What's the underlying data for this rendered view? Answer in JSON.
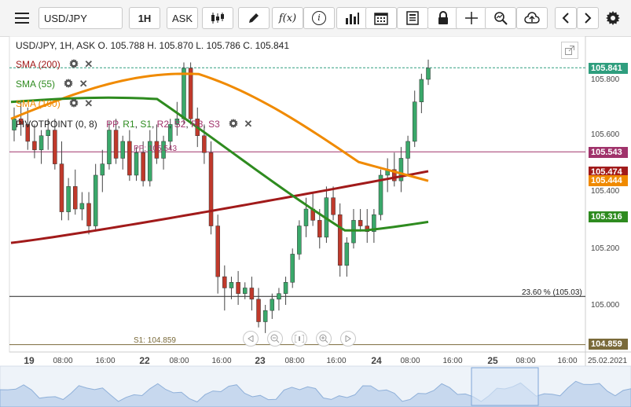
{
  "toolbar": {
    "symbol": "USD/JPY",
    "timeframe": "1H",
    "price_type": "ASK",
    "fx_label": "f(x)",
    "info_label": "i"
  },
  "header": {
    "ohlc": "USD/JPY, 1H, ASK   O. 105.788 H. 105.870 L. 105.786 C. 105.841"
  },
  "indicators": [
    {
      "label": "SMA (200)",
      "color": "#a11a1a"
    },
    {
      "label": "SMA (55)",
      "color": "#2e8b1f"
    },
    {
      "label": "SMA (100)",
      "color": "#f08a00"
    }
  ],
  "pivot": {
    "label_prefix": "PIVOTPOINT (0, 8)",
    "items": [
      "PP",
      "R1",
      "S1",
      "R2",
      "S2",
      "R3",
      "S3"
    ],
    "pp_label": "PP: 105.543",
    "s1_label": "S1: 104.859",
    "fib_label": "23.60 % (105.03)"
  },
  "price_tags": [
    {
      "value": "105.841",
      "color": "#2f9e7e"
    },
    {
      "value": "105.543",
      "color": "#a0336b"
    },
    {
      "value": "105.474",
      "color": "#a11a1a"
    },
    {
      "value": "105.444",
      "color": "#f08a00"
    },
    {
      "value": "105.316",
      "color": "#2e8b1f"
    },
    {
      "value": "104.859",
      "color": "#7a6a3a"
    }
  ],
  "y_axis": [
    "105.800",
    "105.600",
    "105.400",
    "105.200",
    "105.000"
  ],
  "x_axis": [
    {
      "label": "19",
      "big": true
    },
    {
      "label": "08:00"
    },
    {
      "label": "16:00"
    },
    {
      "label": "22",
      "big": true
    },
    {
      "label": "08:00"
    },
    {
      "label": "16:00"
    },
    {
      "label": "23",
      "big": true
    },
    {
      "label": "08:00"
    },
    {
      "label": "16:00"
    },
    {
      "label": "24",
      "big": true
    },
    {
      "label": "08:00"
    },
    {
      "label": "16:00"
    },
    {
      "label": "25",
      "big": true
    },
    {
      "label": "08:00"
    },
    {
      "label": "16:00"
    },
    {
      "label": "25.02.2021"
    }
  ],
  "chart_data": {
    "type": "candlestick",
    "symbol": "USD/JPY",
    "timeframe": "1H",
    "ylim": [
      104.8,
      105.9
    ],
    "last_close": 105.841,
    "levels": {
      "PP": 105.543,
      "S1": 104.859,
      "fib_23_6": 105.03
    },
    "sma": {
      "SMA(200)": 105.474,
      "SMA(100)": 105.444,
      "SMA(55)": 105.316
    },
    "candles": [
      [
        105.62,
        105.7,
        105.58,
        105.66
      ],
      [
        105.66,
        105.72,
        105.6,
        105.64
      ],
      [
        105.64,
        105.7,
        105.55,
        105.58
      ],
      [
        105.58,
        105.64,
        105.52,
        105.55
      ],
      [
        105.55,
        105.62,
        105.5,
        105.6
      ],
      [
        105.6,
        105.66,
        105.55,
        105.62
      ],
      [
        105.62,
        105.66,
        105.48,
        105.5
      ],
      [
        105.5,
        105.58,
        105.3,
        105.33
      ],
      [
        105.33,
        105.45,
        105.3,
        105.42
      ],
      [
        105.42,
        105.48,
        105.32,
        105.34
      ],
      [
        105.34,
        105.4,
        105.3,
        105.36
      ],
      [
        105.36,
        105.4,
        105.25,
        105.28
      ],
      [
        105.28,
        105.5,
        105.26,
        105.46
      ],
      [
        105.46,
        105.55,
        105.4,
        105.5
      ],
      [
        105.5,
        105.65,
        105.48,
        105.62
      ],
      [
        105.62,
        105.66,
        105.5,
        105.52
      ],
      [
        105.52,
        105.6,
        105.48,
        105.58
      ],
      [
        105.58,
        105.62,
        105.44,
        105.46
      ],
      [
        105.46,
        105.56,
        105.44,
        105.54
      ],
      [
        105.54,
        105.58,
        105.42,
        105.44
      ],
      [
        105.44,
        105.62,
        105.42,
        105.58
      ],
      [
        105.58,
        105.64,
        105.5,
        105.52
      ],
      [
        105.52,
        105.6,
        105.48,
        105.58
      ],
      [
        105.58,
        105.66,
        105.55,
        105.64
      ],
      [
        105.64,
        105.72,
        105.6,
        105.66
      ],
      [
        105.66,
        105.86,
        105.64,
        105.84
      ],
      [
        105.84,
        105.86,
        105.64,
        105.66
      ],
      [
        105.66,
        105.7,
        105.56,
        105.6
      ],
      [
        105.6,
        105.64,
        105.5,
        105.54
      ],
      [
        105.54,
        105.58,
        105.25,
        105.28
      ],
      [
        105.28,
        105.32,
        105.04,
        105.1
      ],
      [
        105.1,
        105.14,
        104.98,
        105.06
      ],
      [
        105.06,
        105.1,
        105.02,
        105.08
      ],
      [
        105.08,
        105.12,
        105.0,
        105.04
      ],
      [
        105.04,
        105.08,
        105.02,
        105.06
      ],
      [
        105.06,
        105.1,
        104.98,
        105.02
      ],
      [
        105.02,
        105.06,
        104.92,
        104.94
      ],
      [
        104.94,
        105.0,
        104.9,
        104.98
      ],
      [
        104.98,
        105.04,
        104.95,
        105.02
      ],
      [
        105.02,
        105.06,
        104.98,
        105.04
      ],
      [
        105.04,
        105.1,
        105.0,
        105.08
      ],
      [
        105.08,
        105.2,
        105.06,
        105.18
      ],
      [
        105.18,
        105.3,
        105.16,
        105.28
      ],
      [
        105.28,
        105.38,
        105.24,
        105.34
      ],
      [
        105.34,
        105.4,
        105.28,
        105.3
      ],
      [
        105.3,
        105.34,
        105.2,
        105.24
      ],
      [
        105.24,
        105.42,
        105.22,
        105.38
      ],
      [
        105.38,
        105.42,
        105.3,
        105.32
      ],
      [
        105.32,
        105.36,
        105.1,
        105.14
      ],
      [
        105.14,
        105.24,
        105.1,
        105.22
      ],
      [
        105.22,
        105.34,
        105.2,
        105.3
      ],
      [
        105.3,
        105.34,
        105.26,
        105.28
      ],
      [
        105.28,
        105.34,
        105.22,
        105.26
      ],
      [
        105.26,
        105.34,
        105.22,
        105.32
      ],
      [
        105.32,
        105.48,
        105.3,
        105.46
      ],
      [
        105.46,
        105.52,
        105.4,
        105.48
      ],
      [
        105.48,
        105.54,
        105.42,
        105.44
      ],
      [
        105.44,
        105.56,
        105.4,
        105.52
      ],
      [
        105.52,
        105.6,
        105.46,
        105.58
      ],
      [
        105.58,
        105.76,
        105.56,
        105.72
      ],
      [
        105.72,
        105.82,
        105.68,
        105.8
      ],
      [
        105.8,
        105.87,
        105.78,
        105.84
      ]
    ]
  }
}
